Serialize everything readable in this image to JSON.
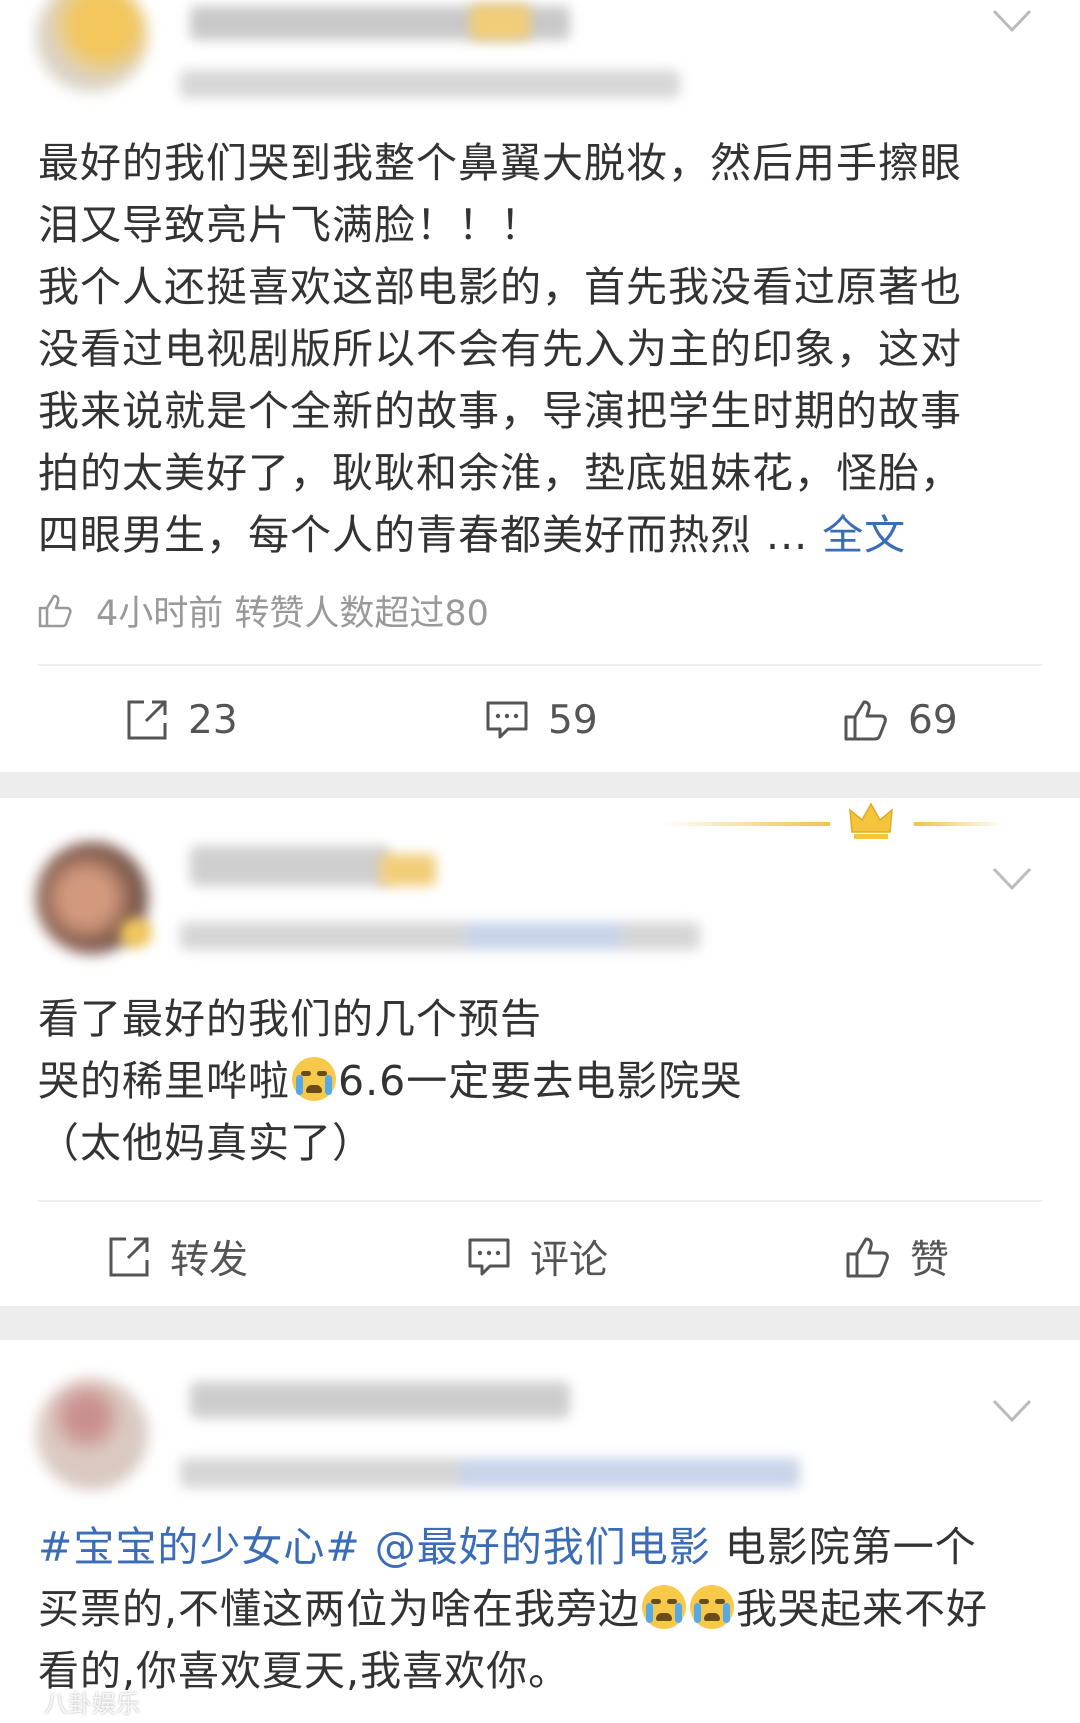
{
  "posts": [
    {
      "text_lines": [
        "最好的我们哭到我整个鼻翼大脱妆，然后用手擦眼",
        "泪又导致亮片飞满脸！！！",
        "我个人还挺喜欢这部电影的，首先我没看过原著也",
        "没看过电视剧版所以不会有先入为主的印象，这对",
        "我来说就是个全新的故事，导演把学生时期的故事",
        "拍的太美好了，耿耿和余淮，垫底姐妹花，怪胎，",
        "四眼男生，每个人的青春都美好而热烈 ..."
      ],
      "more_label": "全文",
      "meta": "4小时前 转赞人数超过80",
      "actions": {
        "repost": "23",
        "comment": "59",
        "like": "69"
      }
    },
    {
      "text_lines": [
        "看了最好的我们的几个预告",
        "哭的稀里哗啦",
        "6.6一定要去电影院哭",
        "（太他妈真实了）"
      ],
      "actions": {
        "repost": "转发",
        "comment": "评论",
        "like": "赞"
      }
    },
    {
      "hashtag": "#宝宝的少女心#",
      "mention": "@最好的我们电影",
      "line1_rest": " 电影院第一个",
      "line2_a": "买票的,不懂这两位为啥在我旁边",
      "line2_b": "我哭起来不好",
      "line3": "看的,你喜欢夏天,我喜欢你。"
    }
  ],
  "watermark": "八卦娱乐"
}
